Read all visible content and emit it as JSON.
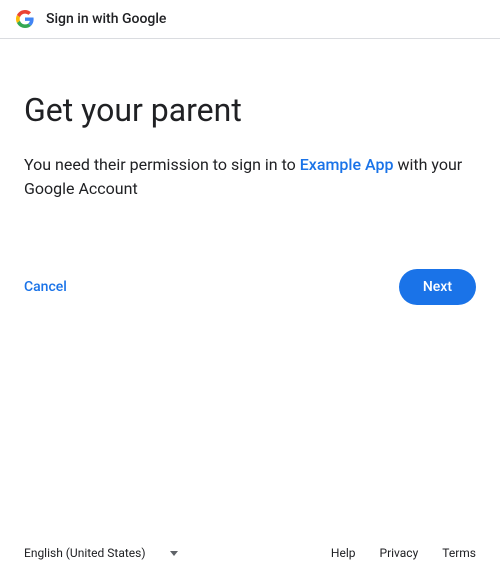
{
  "header": {
    "title": "Sign in with Google"
  },
  "main": {
    "title": "Get your parent",
    "description_prefix": "You need their permission to sign in to ",
    "app_name": "Example App",
    "description_suffix": " with your Google Account"
  },
  "buttons": {
    "cancel": "Cancel",
    "next": "Next"
  },
  "footer": {
    "language": "English (United States)",
    "links": {
      "help": "Help",
      "privacy": "Privacy",
      "terms": "Terms"
    }
  }
}
